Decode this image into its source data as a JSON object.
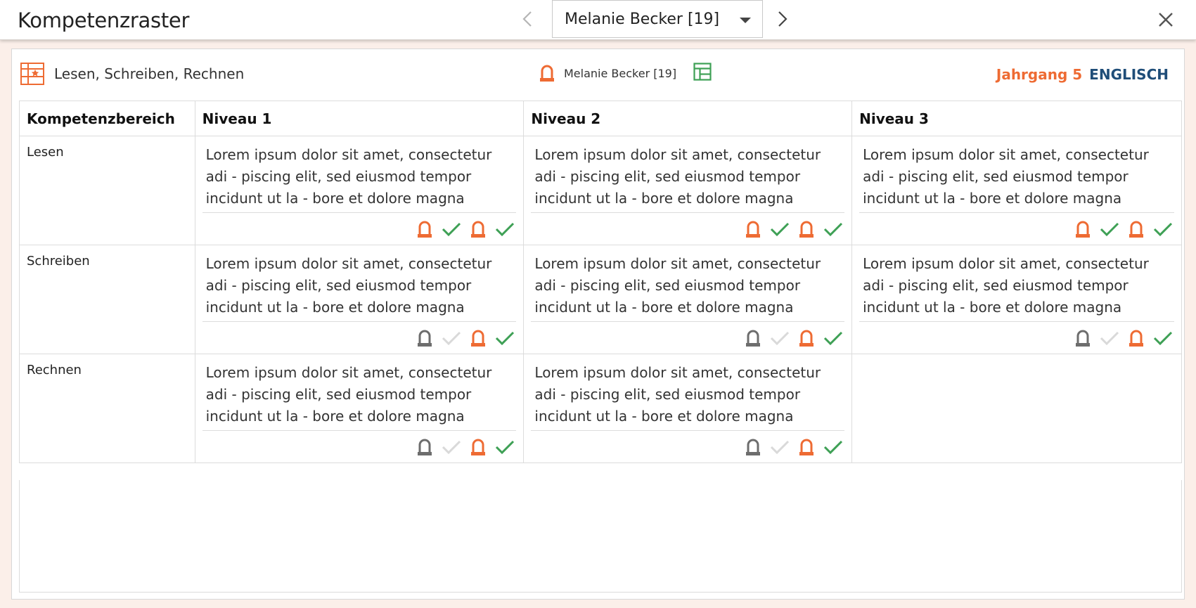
{
  "app": {
    "title": "Kompetenzraster"
  },
  "nav": {
    "student_select": "Melanie Becker [19]"
  },
  "panel": {
    "grid_name": "Lesen, Schreiben, Rechnen",
    "student_name": "Melanie Becker [19]",
    "year": "Jahrgang 5",
    "subject": "ENGLISCH"
  },
  "table": {
    "headers": [
      "Kompetenzbereich",
      "Niveau 1",
      "Niveau 2",
      "Niveau 3"
    ],
    "rows": [
      {
        "label": "Lesen",
        "cells": [
          {
            "text": "Lorem ipsum dolor sit amet, consectetur adi - piscing elit, sed eiusmod tempor incidunt ut la - bore et dolore magna aliqua.",
            "teacher_done": true,
            "teacher_check": true,
            "student_done": true,
            "student_check": true
          },
          {
            "text": "Lorem ipsum dolor sit amet, consectetur adi - piscing elit, sed eiusmod tempor incidunt ut la - bore et dolore magna aliqua.",
            "teacher_done": true,
            "teacher_check": true,
            "student_done": true,
            "student_check": true
          },
          {
            "text": "Lorem ipsum dolor sit amet, consectetur adi - piscing elit, sed eiusmod tempor incidunt ut la - bore et dolore magna aliqua.",
            "teacher_done": true,
            "teacher_check": true,
            "student_done": true,
            "student_check": true
          }
        ]
      },
      {
        "label": "Schreiben",
        "cells": [
          {
            "text": "Lorem ipsum dolor sit amet, consectetur adi - piscing elit, sed eiusmod tempor incidunt ut la - bore et dolore magna aliqua.",
            "teacher_done": false,
            "teacher_check": false,
            "student_done": true,
            "student_check": true
          },
          {
            "text": "Lorem ipsum dolor sit amet, consectetur adi - piscing elit, sed eiusmod tempor incidunt ut la - bore et dolore magna aliqua.",
            "teacher_done": false,
            "teacher_check": false,
            "student_done": true,
            "student_check": true
          },
          {
            "text": "Lorem ipsum dolor sit amet, consectetur adi - piscing elit, sed eiusmod tempor incidunt ut la - bore et dolore magna aliqua.",
            "teacher_done": false,
            "teacher_check": false,
            "student_done": true,
            "student_check": true
          }
        ]
      },
      {
        "label": "Rechnen",
        "cells": [
          {
            "text": "Lorem ipsum dolor sit amet, consectetur adi - piscing elit, sed eiusmod tempor incidunt ut la - bore et dolore magna aliqua.",
            "teacher_done": false,
            "teacher_check": false,
            "student_done": true,
            "student_check": true
          },
          {
            "text": "Lorem ipsum dolor sit amet, consectetur adi - piscing elit, sed eiusmod tempor incidunt ut la - bore et dolore magna aliqua.",
            "teacher_done": false,
            "teacher_check": false,
            "student_done": true,
            "student_check": true
          },
          null
        ]
      }
    ]
  },
  "colors": {
    "accent_orange": "#ee6b33",
    "check_green": "#3ea055",
    "inactive_gray": "#6d6d6d",
    "inactive_check": "#d9d9d9",
    "subject_blue": "#1f4d78"
  },
  "icons": {
    "prev": "chevron-left-icon",
    "next": "chevron-right-icon",
    "close": "close-icon",
    "grid": "competence-grid-icon",
    "student": "student-icon",
    "table": "table-view-icon",
    "check": "check-icon"
  }
}
